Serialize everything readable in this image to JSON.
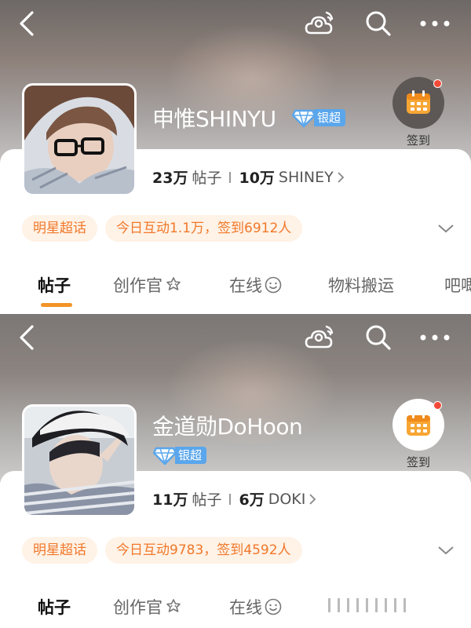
{
  "panels": [
    {
      "name": "申惟SHINYU",
      "rank_label": "银超",
      "checkin_label": "签到",
      "stats": {
        "posts_count": "23万",
        "posts_label": "帖子",
        "fans_count": "10万",
        "fans_label": "SHINEY"
      },
      "tags": [
        "明星超话",
        "今日互动1.1万，签到6912人"
      ],
      "tabs": [
        "帖子",
        "创作官",
        "在线",
        "物料搬运",
        "吧唧"
      ],
      "active_tab": "帖子"
    },
    {
      "name": "金道勋DoHoon",
      "rank_label": "银超",
      "checkin_label": "签到",
      "stats": {
        "posts_count": "11万",
        "posts_label": "帖子",
        "fans_count": "6万",
        "fans_label": "DOKI"
      },
      "tags": [
        "明星超话",
        "今日互动9783，签到4592人"
      ],
      "tabs": [
        "帖子",
        "创作官",
        "在线"
      ],
      "active_tab": "帖子"
    }
  ],
  "icons": [
    "back-arrow-icon",
    "weather-cloud-icon",
    "search-icon",
    "more-dots-icon",
    "calendar-icon",
    "chevron-right-icon",
    "chevron-down-icon",
    "gem-badge-icon",
    "badge-flower-icon",
    "smiley-icon"
  ],
  "colors": {
    "accent_orange": "#f39327",
    "tag_text": "#f0782a",
    "tag_bg": "#fff2e6",
    "badge_blue": "#5aa6ec",
    "notify_red": "#f24a38"
  }
}
